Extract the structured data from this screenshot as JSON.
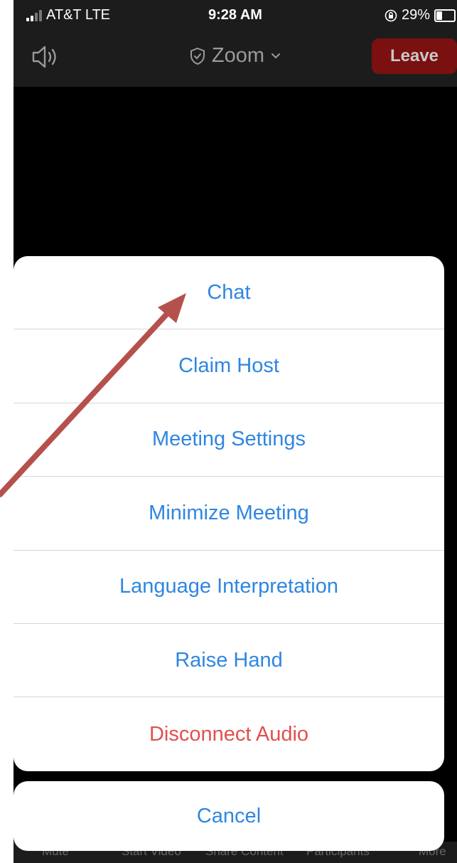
{
  "status_bar": {
    "carrier": "AT&T  LTE",
    "time": "9:28 AM",
    "battery_text": "29%",
    "battery_level": 0.29
  },
  "header": {
    "title": "Zoom",
    "leave_label": "Leave",
    "icons": [
      "speaker-icon",
      "shield-check-icon",
      "chevron-down-icon"
    ]
  },
  "action_sheet": {
    "items": [
      {
        "label": "Chat",
        "style": "default"
      },
      {
        "label": "Claim Host",
        "style": "default"
      },
      {
        "label": "Meeting Settings",
        "style": "default"
      },
      {
        "label": "Minimize Meeting",
        "style": "default"
      },
      {
        "label": "Language Interpretation",
        "style": "default"
      },
      {
        "label": "Raise Hand",
        "style": "default"
      },
      {
        "label": "Disconnect Audio",
        "style": "destructive"
      }
    ],
    "cancel_label": "Cancel"
  },
  "toolbar": {
    "items": [
      "Mute",
      "Start Video",
      "Share Content",
      "Participants",
      "More"
    ]
  },
  "colors": {
    "action_blue": "#2f86e0",
    "destructive_red": "#e0504e",
    "leave_red": "#7a1010",
    "annotation_arrow": "#b5514d"
  }
}
